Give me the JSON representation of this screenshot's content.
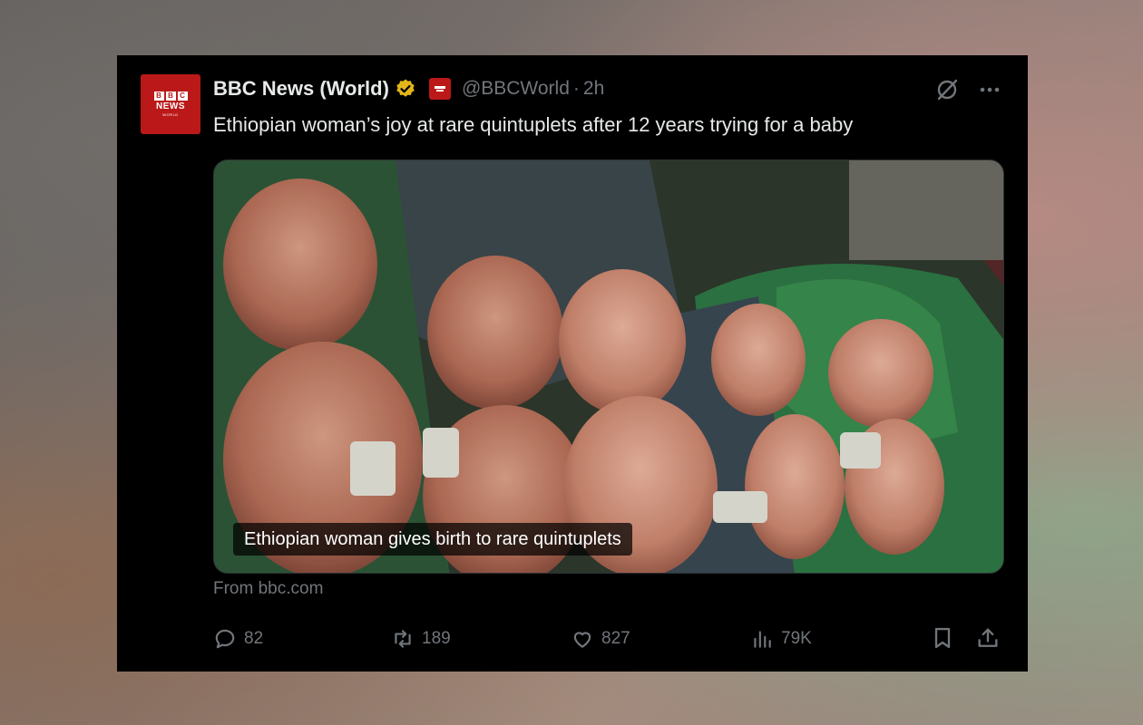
{
  "tweet": {
    "display_name": "BBC News (World)",
    "handle": "@BBCWorld",
    "separator": "·",
    "time": "2h",
    "text": "Ethiopian woman’s joy at rare quintuplets after 12 years trying for a baby",
    "avatar": {
      "blocks": [
        "B",
        "B",
        "C"
      ],
      "line1": "NEWS",
      "line2": "WORLD"
    },
    "media": {
      "caption": "Ethiopian woman gives birth to rare quintuplets"
    },
    "source": "From bbc.com",
    "actions": {
      "replies": "82",
      "reposts": "189",
      "likes": "827",
      "views": "79K"
    },
    "icons": [
      "grok-icon",
      "more-icon",
      "reply-icon",
      "repost-icon",
      "like-icon",
      "views-icon",
      "bookmark-icon",
      "share-icon",
      "verified-badge-icon"
    ]
  },
  "colors": {
    "tweet_bg": "#000000",
    "text": "#e7e9ea",
    "muted": "#71767b",
    "bbc_red": "#bb1919",
    "verified_gold": "#e2b719"
  }
}
